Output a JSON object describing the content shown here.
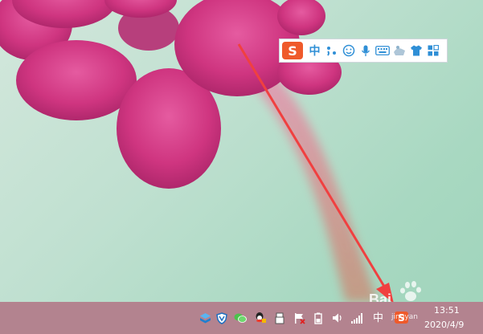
{
  "ime_toolbar": {
    "logo_letter": "S",
    "input_mode": "中",
    "items": [
      "punctuation-icon",
      "emoji-icon",
      "microphone-icon",
      "keyboard-icon",
      "toolbox-icon",
      "skin-icon",
      "apps-grid-icon"
    ],
    "accent_color": "#2f8fd6",
    "logo_color": "#ef5a2b"
  },
  "taskbar": {
    "tray_icons": [
      "box-icon",
      "shield-icon",
      "wechat-icon",
      "qq-icon",
      "usb-icon",
      "flag-icon",
      "battery-icon",
      "volume-icon",
      "signal-icon"
    ],
    "input_mode": "中",
    "ime_logo_letter": "S",
    "clock_time": "13:51",
    "clock_date": "2020/4/9"
  },
  "watermark": {
    "brand": "Bai",
    "subtitle": "jingyan"
  },
  "colors": {
    "taskbar": "#b3838f",
    "arrow": "#f04040",
    "flower": "#d83a86"
  }
}
